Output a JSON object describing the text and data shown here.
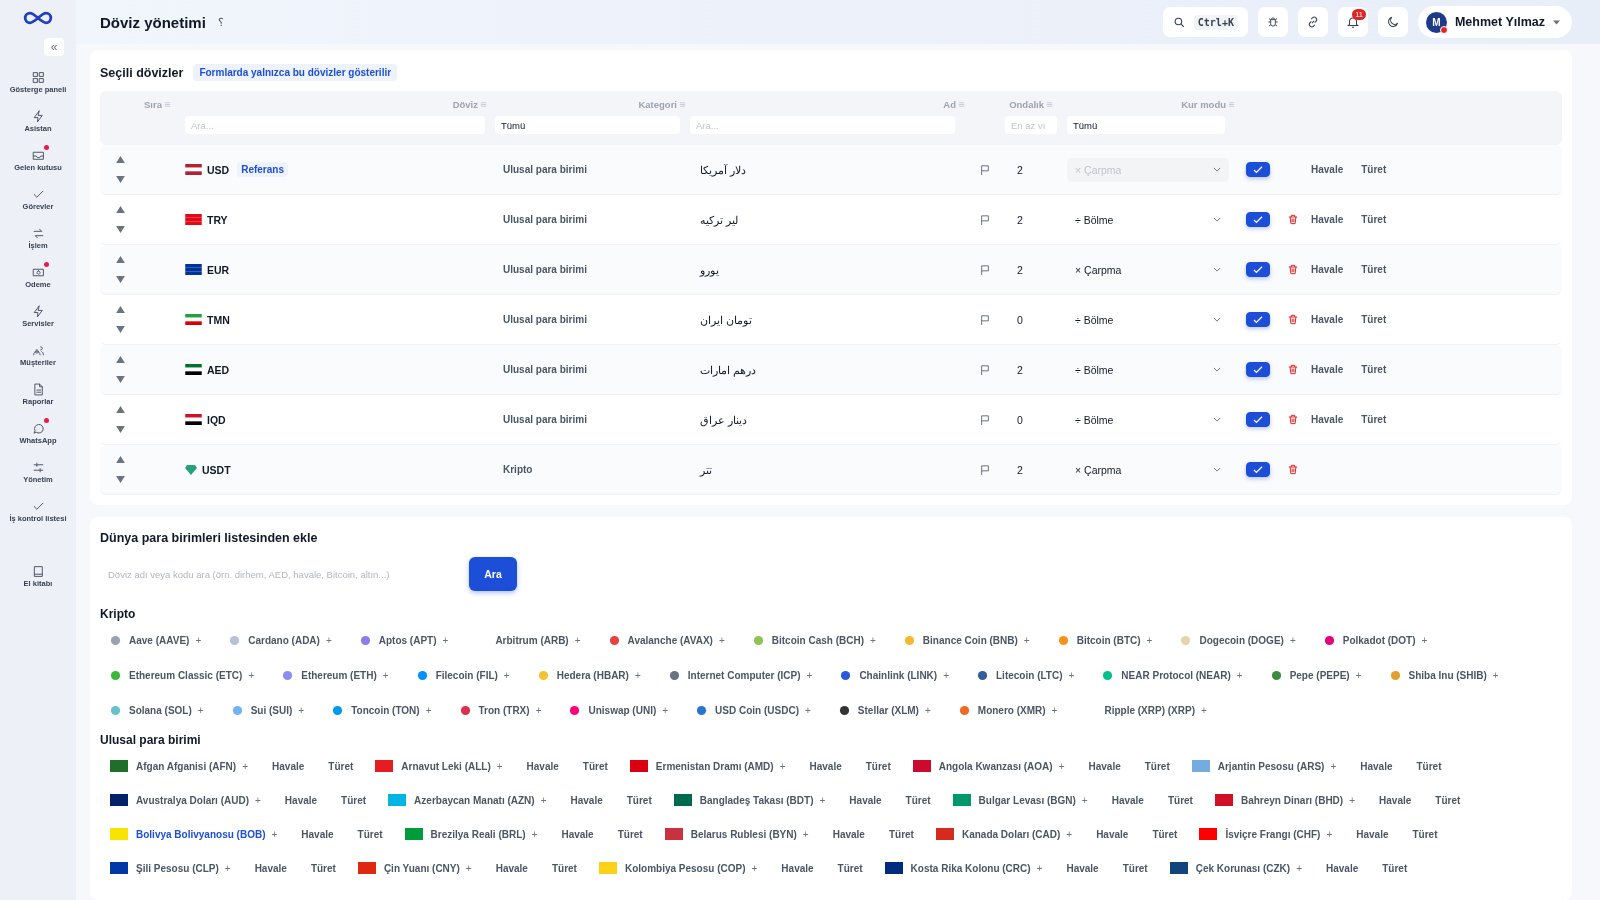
{
  "sidebar": {
    "collapse": "«",
    "items": [
      {
        "label": "Gösterge paneli",
        "dot": false
      },
      {
        "label": "Asistan",
        "dot": false
      },
      {
        "label": "Gelen kutusu",
        "dot": true
      },
      {
        "label": "Görevler",
        "dot": false
      },
      {
        "label": "İşlem",
        "dot": false
      },
      {
        "label": "Odeme",
        "dot": true
      },
      {
        "label": "Servisler",
        "dot": false
      },
      {
        "label": "Müşteriler",
        "dot": false
      },
      {
        "label": "Raporlar",
        "dot": false
      },
      {
        "label": "WhatsApp",
        "dot": true
      },
      {
        "label": "Yönetim",
        "dot": false
      },
      {
        "label": "İş kontrol listesi",
        "dot": false
      },
      {
        "label": "El kitabı",
        "dot": false
      }
    ]
  },
  "header": {
    "title": "Döviz yönetimi",
    "help": "؟",
    "search_shortcut": "Ctrl+K",
    "notifications": "11",
    "user": {
      "initial": "M",
      "name": "Mehmet Yılmaz",
      "online_dot": true
    }
  },
  "selected_currencies": {
    "title": "Seçili dövizler",
    "note": "Formlarda yalnızca bu dövizler gösterilir",
    "columns": [
      "Sıra",
      "Döviz",
      "Kategori",
      "Ad",
      "Ondalık",
      "Kur modu"
    ],
    "filters": {
      "currency": {
        "placeholder": "Ara..."
      },
      "category": {
        "value": "Tümü"
      },
      "name": {
        "placeholder": "Ara..."
      },
      "decimals": {
        "placeholder": "En az vı"
      },
      "mode": {
        "value": "Tümü"
      }
    },
    "rows": [
      {
        "code": "USD",
        "reference": "Referans",
        "category": "Ulusal para birimi",
        "name": "دلار آمریکا",
        "decimals": "2",
        "mode": "× Çarpma",
        "mode_disabled": true,
        "enabled": true,
        "deletable": false,
        "actions": [
          "Havale",
          "Türet"
        ]
      },
      {
        "code": "TRY",
        "category": "Ulusal para birimi",
        "name": "لیر ترکیه",
        "decimals": "2",
        "mode": "÷ Bölme",
        "mode_disabled": false,
        "enabled": true,
        "deletable": true,
        "actions": [
          "Havale",
          "Türet"
        ]
      },
      {
        "code": "EUR",
        "category": "Ulusal para birimi",
        "name": "یورو",
        "decimals": "2",
        "mode": "× Çarpma",
        "mode_disabled": false,
        "enabled": true,
        "deletable": true,
        "actions": [
          "Havale",
          "Türet"
        ]
      },
      {
        "code": "TMN",
        "category": "Ulusal para birimi",
        "name": "تومان ایران",
        "decimals": "0",
        "mode": "÷ Bölme",
        "mode_disabled": false,
        "enabled": true,
        "deletable": true,
        "actions": [
          "Havale",
          "Türet"
        ]
      },
      {
        "code": "AED",
        "category": "Ulusal para birimi",
        "name": "درهم امارات",
        "decimals": "2",
        "mode": "÷ Bölme",
        "mode_disabled": false,
        "enabled": true,
        "deletable": true,
        "actions": [
          "Havale",
          "Türet"
        ]
      },
      {
        "code": "IQD",
        "category": "Ulusal para birimi",
        "name": "دینار عراق",
        "decimals": "0",
        "mode": "÷ Bölme",
        "mode_disabled": false,
        "enabled": true,
        "deletable": true,
        "actions": [
          "Havale",
          "Türet"
        ]
      },
      {
        "code": "USDT",
        "category": "Kripto",
        "name": "تتر",
        "decimals": "2",
        "mode": "× Çarpma",
        "mode_disabled": false,
        "enabled": true,
        "deletable": true
      }
    ]
  },
  "add_from_world": {
    "title": "Dünya para birimleri listesinden ekle",
    "search": {
      "placeholder": "Döviz adı veya kodu ara (örn. dirhem, AED, havale, Bitcoin, altın...)"
    },
    "search_button": "Ara",
    "groups": [
      {
        "kind": "crypto",
        "title": "Kripto",
        "items": [
          {
            "label": "Aave (AAVE)",
            "add": "+",
            "color": "#9aa3b5"
          },
          {
            "label": "Cardano (ADA)",
            "add": "+",
            "color": "#b8c0d6"
          },
          {
            "label": "Aptos (APT)",
            "add": "+",
            "color": "#8c7ee8"
          },
          {
            "label": "Arbitrum (ARB)",
            "add": "+"
          },
          {
            "label": "Avalanche (AVAX)",
            "add": "+",
            "color": "#e84142"
          },
          {
            "label": "Bitcoin Cash (BCH)",
            "add": "+",
            "color": "#8dc351"
          },
          {
            "label": "Binance Coin (BNB)",
            "add": "+",
            "color": "#f3ba2f"
          },
          {
            "label": "Bitcoin (BTC)",
            "add": "+",
            "color": "#f7931a"
          },
          {
            "label": "Dogecoin (DOGE)",
            "add": "+",
            "color": "#e1d7a8"
          },
          {
            "label": "Polkadot (DOT)",
            "add": "+",
            "color": "#e6007a"
          },
          {
            "label": "Ethereum Classic (ETC)",
            "add": "+",
            "color": "#3ab83a"
          },
          {
            "label": "Ethereum (ETH)",
            "add": "+",
            "color": "#8c8cf0"
          },
          {
            "label": "Filecoin (FIL)",
            "add": "+",
            "color": "#0090ff"
          },
          {
            "label": "Hedera (HBAR)",
            "add": "+",
            "color": "#f2c230"
          },
          {
            "label": "Internet Computer (ICP)",
            "add": "+",
            "color": "#6b7280"
          },
          {
            "label": "Chainlink (LINK)",
            "add": "+",
            "color": "#2a5ada"
          },
          {
            "label": "Litecoin (LTC)",
            "add": "+",
            "color": "#345d9d"
          },
          {
            "label": "NEAR Protocol (NEAR)",
            "add": "+",
            "color": "#00c08b"
          },
          {
            "label": "Pepe (PEPE)",
            "add": "+",
            "color": "#3d8c40"
          },
          {
            "label": "Shiba Inu (SHIB)",
            "add": "+",
            "color": "#e0a030"
          },
          {
            "label": "Solana (SOL)",
            "add": "+",
            "color": "#66c2c9"
          },
          {
            "label": "Sui (SUI)",
            "add": "+",
            "color": "#6fb4f0"
          },
          {
            "label": "Toncoin (TON)",
            "add": "+",
            "color": "#0098ea"
          },
          {
            "label": "Tron (TRX)",
            "add": "+",
            "color": "#d9304f"
          },
          {
            "label": "Uniswap (UNI)",
            "add": "+",
            "color": "#ff007a"
          },
          {
            "label": "USD Coin (USDC)",
            "add": "+",
            "color": "#2775ca"
          },
          {
            "label": "Stellar (XLM)",
            "add": "+",
            "color": "#333333"
          },
          {
            "label": "Monero (XMR)",
            "add": "+",
            "color": "#f26822"
          },
          {
            "label": "Ripple (XRP) (XRP)",
            "add": "+"
          }
        ]
      },
      {
        "kind": "national",
        "title": "Ulusal para birimi",
        "items": [
          {
            "label": "Afgan Afganisi (AFN)",
            "add": "+",
            "color": "#1f6f2a",
            "selected": false,
            "actions": [
              "Havale",
              "Türet"
            ]
          },
          {
            "label": "Arnavut Leki (ALL)",
            "add": "+",
            "color": "#e41e20",
            "selected": false,
            "actions": [
              "Havale",
              "Türet"
            ]
          },
          {
            "label": "Ermenistan Dramı (AMD)",
            "add": "+",
            "color": "#d90012",
            "selected": false,
            "actions": [
              "Havale",
              "Türet"
            ]
          },
          {
            "label": "Angola Kwanzası (AOA)",
            "add": "+",
            "color": "#cc092f",
            "selected": false,
            "actions": [
              "Havale",
              "Türet"
            ]
          },
          {
            "label": "Arjantin Pesosu (ARS)",
            "add": "+",
            "color": "#74acdf",
            "selected": false,
            "actions": [
              "Havale",
              "Türet"
            ]
          },
          {
            "label": "Avustralya Doları (AUD)",
            "add": "+",
            "color": "#012169",
            "selected": false,
            "actions": [
              "Havale",
              "Türet"
            ]
          },
          {
            "label": "Azerbaycan Manatı (AZN)",
            "add": "+",
            "color": "#00b5e2",
            "selected": false,
            "actions": [
              "Havale",
              "Türet"
            ]
          },
          {
            "label": "Bangladeş Takası (BDT)",
            "add": "+",
            "color": "#006a4e",
            "selected": false,
            "actions": [
              "Havale",
              "Türet"
            ]
          },
          {
            "label": "Bulgar Levası (BGN)",
            "add": "+",
            "color": "#00966e",
            "selected": false,
            "actions": [
              "Havale",
              "Türet"
            ]
          },
          {
            "label": "Bahreyn Dinarı (BHD)",
            "add": "+",
            "color": "#ce1126",
            "selected": false,
            "actions": [
              "Havale",
              "Türet"
            ]
          },
          {
            "label": "Bolivya Bolivyanosu (BOB)",
            "add": "+",
            "color": "#f9e300",
            "selected": true,
            "actions": [
              "Havale",
              "Türet"
            ]
          },
          {
            "label": "Brezilya Reali (BRL)",
            "add": "+",
            "color": "#009c3b",
            "selected": false,
            "actions": [
              "Havale",
              "Türet"
            ]
          },
          {
            "label": "Belarus Rublesi (BYN)",
            "add": "+",
            "color": "#c8313e",
            "selected": false,
            "actions": [
              "Havale",
              "Türet"
            ]
          },
          {
            "label": "Kanada Doları (CAD)",
            "add": "+",
            "color": "#d52b1e",
            "selected": false,
            "actions": [
              "Havale",
              "Türet"
            ]
          },
          {
            "label": "İsviçre Frangı (CHF)",
            "add": "+",
            "color": "#ff0000",
            "selected": false,
            "actions": [
              "Havale",
              "Türet"
            ]
          },
          {
            "label": "Şili Pesosu (CLP)",
            "add": "+",
            "color": "#0039a6",
            "selected": false,
            "actions": [
              "Havale",
              "Türet"
            ]
          },
          {
            "label": "Çin Yuanı (CNY)",
            "add": "+",
            "color": "#de2910",
            "selected": false,
            "actions": [
              "Havale",
              "Türet"
            ]
          },
          {
            "label": "Kolombiya Pesosu (COP)",
            "add": "+",
            "color": "#fcd116",
            "selected": false,
            "actions": [
              "Havale",
              "Türet"
            ]
          },
          {
            "label": "Kosta Rika Kolonu (CRC)",
            "add": "+",
            "color": "#002b7f",
            "selected": false,
            "actions": [
              "Havale",
              "Türet"
            ]
          },
          {
            "label": "Çek Korunası (CZK)",
            "add": "+",
            "color": "#11457e",
            "selected": false,
            "actions": [
              "Havale",
              "Türet"
            ]
          }
        ]
      }
    ]
  }
}
